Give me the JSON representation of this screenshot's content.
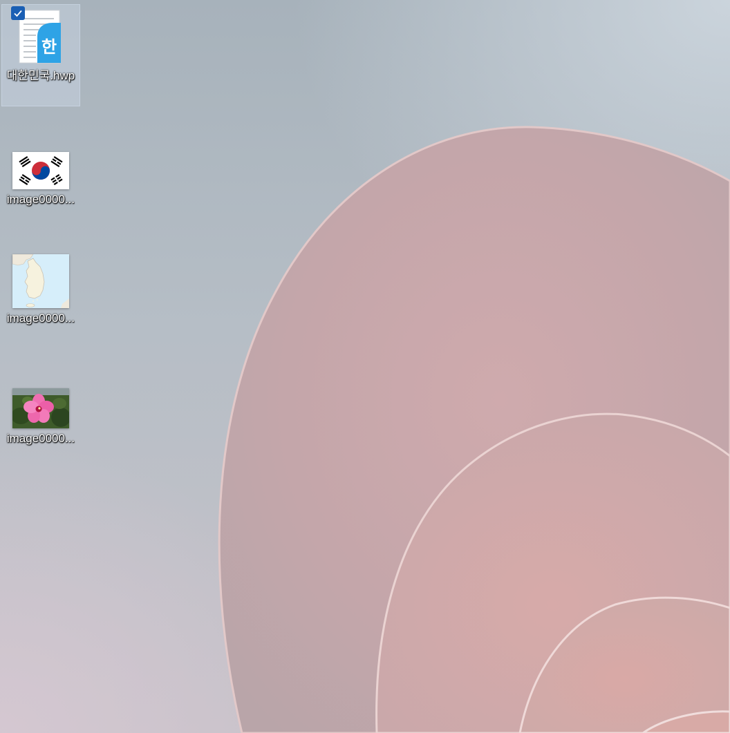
{
  "desktop": {
    "icons": [
      {
        "label": "대한민국.hwp",
        "icon": "hwp-document-icon",
        "selected": true,
        "checked": true
      },
      {
        "label": "image0000...",
        "icon": "korean-flag-thumbnail",
        "selected": false
      },
      {
        "label": "image0000...",
        "icon": "korea-map-thumbnail",
        "selected": false
      },
      {
        "label": "image0000...",
        "icon": "hibiscus-flower-thumbnail",
        "selected": false
      }
    ]
  },
  "colors": {
    "selection_check": "#1a5fb4",
    "hwp_accent": "#2ea3e6",
    "wallpaper_petal": "#d9b3b3"
  }
}
